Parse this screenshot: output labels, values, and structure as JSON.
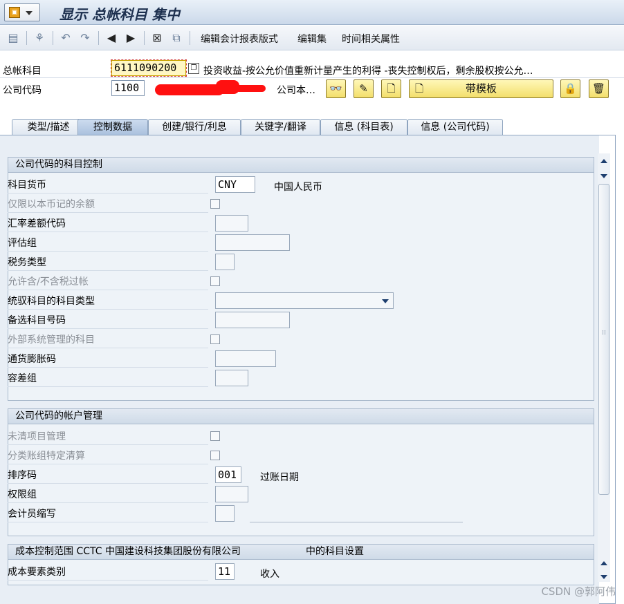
{
  "window": {
    "title": "显示 总帐科目 集中"
  },
  "toolbar": {
    "menu": [
      "编辑会计报表版式",
      "编辑集",
      "时间相关属性"
    ]
  },
  "header": {
    "gl_account_label": "总帐科目",
    "gl_account_value": "6111090200",
    "gl_account_desc": "投资收益-按公允价值重新计量产生的利得 -丧失控制权后，剩余股权按公允…",
    "company_code_label": "公司代码",
    "company_code_value": "1100",
    "company_desc_suffix": "公司本…",
    "with_template_label": "带模板"
  },
  "tabs": [
    {
      "label": "类型/描述",
      "active": false
    },
    {
      "label": "控制数据",
      "active": true
    },
    {
      "label": "创建/银行/利息",
      "active": false
    },
    {
      "label": "关键字/翻译",
      "active": false
    },
    {
      "label": "信息 (科目表)",
      "active": false
    },
    {
      "label": "信息 (公司代码)",
      "active": false
    }
  ],
  "group1": {
    "title": "公司代码的科目控制",
    "currency_label": "科目货币",
    "currency_value": "CNY",
    "currency_desc": "中国人民币",
    "local_only_label": "仅限以本币记的余额",
    "exch_diff_label": "汇率差额代码",
    "valuation_group_label": "评估组",
    "tax_category_label": "税务类型",
    "no_tax_label": "允许含/不含税过帐",
    "recon_type_label": "统驭科目的科目类型",
    "alt_account_label": "备选科目号码",
    "ext_managed_label": "外部系统管理的科目",
    "inflation_key_label": "通货膨胀码",
    "tolerance_group_label": "容差组"
  },
  "group2": {
    "title": "公司代码的帐户管理",
    "open_item_label": "未清项目管理",
    "ledger_clearing_label": "分类账组特定清算",
    "sort_key_label": "排序码",
    "sort_key_value": "001",
    "sort_key_desc": "过账日期",
    "auth_group_label": "权限组",
    "clerk_label": "会计员缩写"
  },
  "group3": {
    "title_prefix": "成本控制范围 CCTC 中国建设科技集团股份有限公司",
    "title_suffix": "中的科目设置",
    "cost_elem_label": "成本要素类别",
    "cost_elem_value": "11",
    "cost_elem_desc": "收入"
  },
  "watermark": "CSDN @郭阿伟"
}
